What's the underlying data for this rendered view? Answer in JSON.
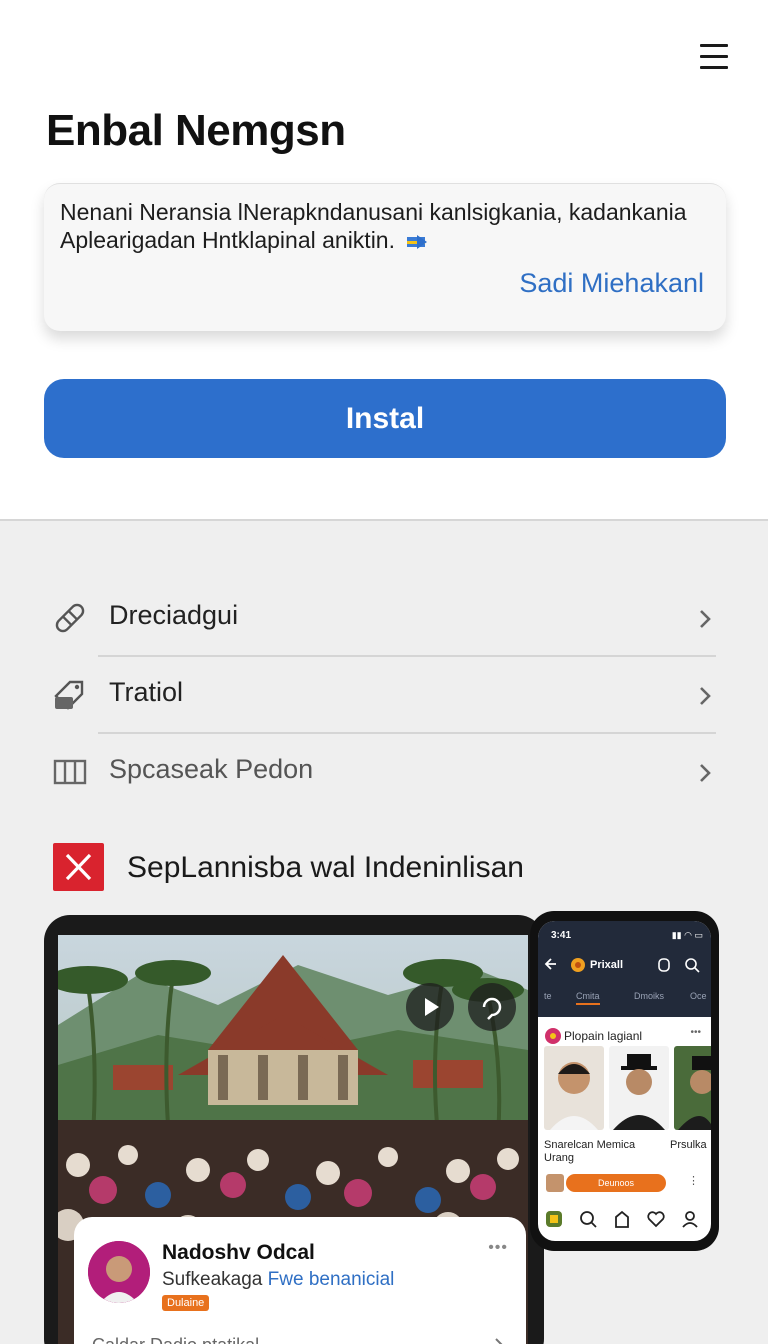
{
  "header": {
    "title": "Enbal Nemgsn",
    "menu_icon": "hamburger-menu-icon"
  },
  "card": {
    "text": "Nenani Neransia lNerapkndanusani kanlsigkania, kadankania Aplearigadan Hntklapinal aniktin.",
    "link": "Sadi Miehakanl"
  },
  "install_label": "Instal",
  "list": [
    {
      "label": "Dreciadgui",
      "icon": "bandage-icon"
    },
    {
      "label": "Tratiol",
      "icon": "tag-icon"
    },
    {
      "label": "Spcaseak Pedon",
      "icon": "book-icon"
    }
  ],
  "section": {
    "title": "SepLannisba wal Indeninlisan",
    "icon": "close-icon"
  },
  "tablet": {
    "name": "Nadoshv Odcal",
    "subtitle": "Sufkeakaga",
    "subtitle_link": "Fwe benanicial",
    "badge": "Dulaine",
    "footer": "Caldar Dadio ptatikal"
  },
  "phone": {
    "time": "3:41",
    "app_name": "Prixall",
    "tabs": [
      "te",
      "Cmita",
      "Dmoiks",
      "Oce"
    ],
    "post_header": "Plopain lagianl",
    "caption_1": "Snarelcan Memica Urang",
    "caption_2": "Prsulka",
    "button": "Deunoos"
  },
  "colors": {
    "accent": "#2d6fcc",
    "brand_red": "#d9232e",
    "orange": "#e8711d"
  }
}
